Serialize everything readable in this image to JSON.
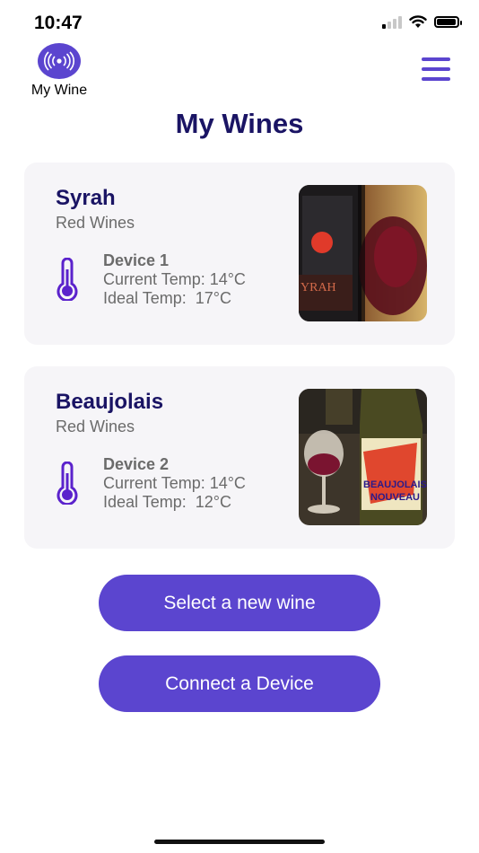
{
  "status_bar": {
    "time": "10:47"
  },
  "header": {
    "logo_label": "My Wine",
    "logo_icon": "broadcast-icon",
    "menu_icon": "hamburger-icon"
  },
  "page": {
    "title": "My Wines"
  },
  "wines": [
    {
      "name": "Syrah",
      "category": "Red Wines",
      "device": "Device 1",
      "current_temp": "Current Temp: 14°C",
      "ideal_temp": "Ideal Temp:  17°C",
      "icon": "thermometer-icon"
    },
    {
      "name": "Beaujolais",
      "category": "Red Wines",
      "device": "Device 2",
      "current_temp": "Current Temp: 14°C",
      "ideal_temp": "Ideal Temp:  12°C",
      "icon": "thermometer-icon"
    }
  ],
  "actions": {
    "select_wine": "Select a new wine",
    "connect_device": "Connect a Device"
  },
  "colors": {
    "accent": "#5b45cf",
    "title": "#1a1464",
    "card_bg": "#f6f5f8",
    "muted_text": "#6b6b6b"
  }
}
